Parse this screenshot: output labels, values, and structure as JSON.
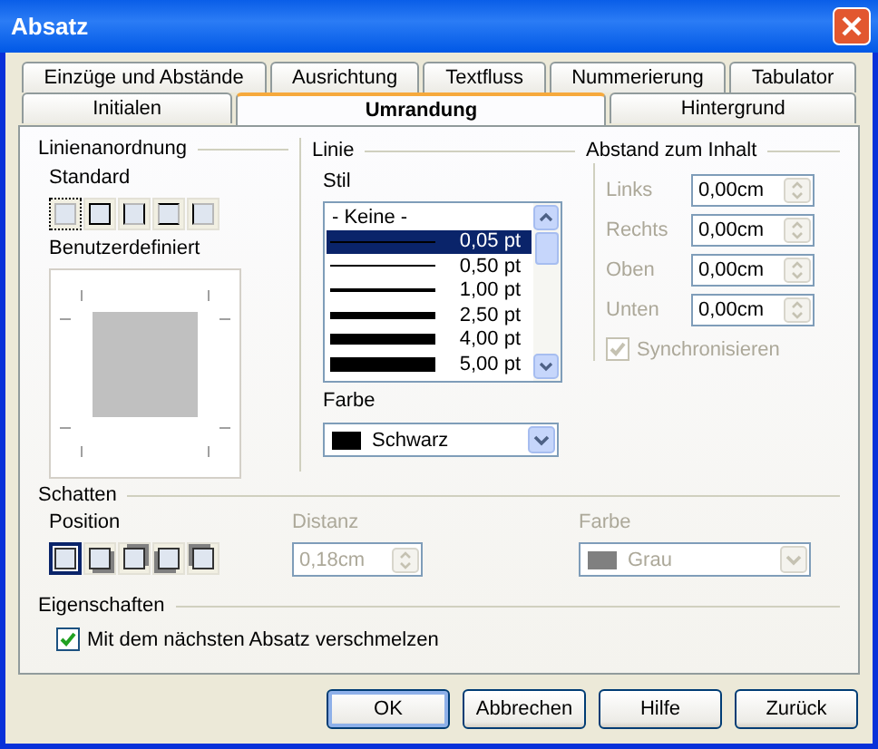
{
  "window": {
    "title": "Absatz"
  },
  "tabs": [
    [
      {
        "label": "Einzüge und Abstände",
        "selected": false
      },
      {
        "label": "Ausrichtung",
        "selected": false
      },
      {
        "label": "Textfluss",
        "selected": false
      },
      {
        "label": "Nummerierung",
        "selected": false
      },
      {
        "label": "Tabulator",
        "selected": false
      }
    ],
    [
      {
        "label": "Initialen",
        "selected": false
      },
      {
        "label": "Umrandung",
        "selected": true
      },
      {
        "label": "Hintergrund",
        "selected": false
      }
    ]
  ],
  "line_arrangement": {
    "title": "Linienanordnung",
    "standard_label": "Standard",
    "presets": [
      {
        "kind": "none",
        "selected": true
      },
      {
        "kind": "all",
        "selected": false
      },
      {
        "kind": "left-right",
        "selected": false
      },
      {
        "kind": "top-bottom",
        "selected": false
      },
      {
        "kind": "left",
        "selected": false
      }
    ],
    "custom_label": "Benutzerdefiniert"
  },
  "line": {
    "title": "Linie",
    "style_label": "Stil",
    "styles": [
      {
        "label": "- Keine -",
        "kind": "none",
        "selected": false
      },
      {
        "label": "0,05 pt",
        "kind": "line",
        "selected": true
      },
      {
        "label": "0,50 pt",
        "kind": "line",
        "selected": false
      },
      {
        "label": "1,00 pt",
        "kind": "line",
        "selected": false
      },
      {
        "label": "2,50 pt",
        "kind": "line",
        "selected": false
      },
      {
        "label": "4,00 pt",
        "kind": "line",
        "selected": false
      },
      {
        "label": "5,00 pt",
        "kind": "line",
        "selected": false
      }
    ],
    "color_label": "Farbe",
    "color": {
      "value": "Schwarz",
      "color": "#000000"
    }
  },
  "spacing": {
    "title": "Abstand zum Inhalt",
    "fields": [
      {
        "label": "Links",
        "value": "0,00cm",
        "disabled": true
      },
      {
        "label": "Rechts",
        "value": "0,00cm",
        "disabled": true
      },
      {
        "label": "Oben",
        "value": "0,00cm",
        "disabled": true
      },
      {
        "label": "Unten",
        "value": "0,00cm",
        "disabled": true
      }
    ],
    "sync": {
      "label": "Synchronisieren",
      "checked": true,
      "disabled": true
    }
  },
  "shadow": {
    "title": "Schatten",
    "position_label": "Position",
    "positions": [
      {
        "kind": "none",
        "selected": true
      },
      {
        "kind": "bottom-right",
        "selected": false
      },
      {
        "kind": "top-right",
        "selected": false
      },
      {
        "kind": "bottom-left",
        "selected": false
      },
      {
        "kind": "top-left",
        "selected": false
      }
    ],
    "distance": {
      "label": "Distanz",
      "value": "0,18cm",
      "disabled": true
    },
    "color": {
      "label": "Farbe",
      "value": "Grau",
      "color": "#808080",
      "disabled": true
    }
  },
  "properties": {
    "title": "Eigenschaften",
    "merge": {
      "label": "Mit dem nächsten Absatz verschmelzen",
      "checked": true
    }
  },
  "buttons": [
    {
      "label": "OK",
      "default": true
    },
    {
      "label": "Abbrechen",
      "default": false
    },
    {
      "label": "Hilfe",
      "default": false
    },
    {
      "label": "Zurück",
      "default": false
    }
  ]
}
